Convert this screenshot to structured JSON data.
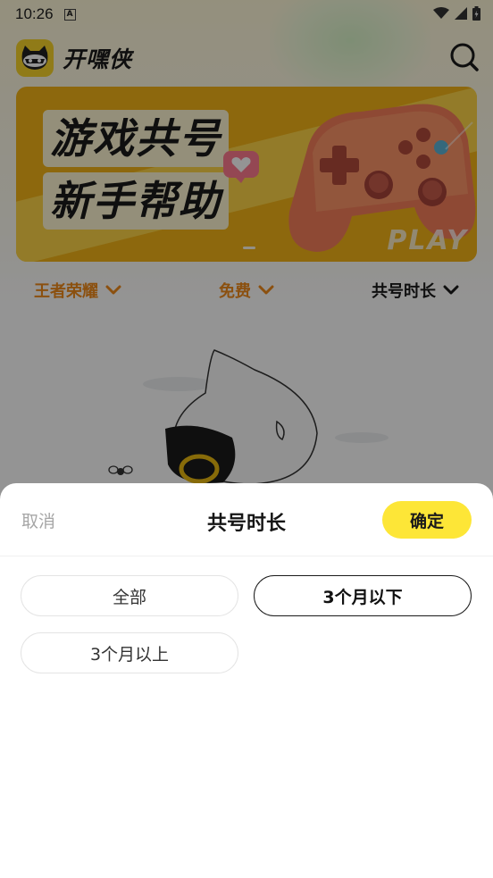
{
  "status_bar": {
    "time": "10:26",
    "notification_icon": "A"
  },
  "header": {
    "brand": "开嘿侠",
    "logo_icon": "raccoon-logo-icon",
    "search_icon": "search-icon"
  },
  "banner": {
    "line1": "游戏共号",
    "line2": "新手帮助",
    "overlay_text": "PLAY"
  },
  "filters": [
    {
      "label": "王者荣耀",
      "color": "#f08a1b"
    },
    {
      "label": "免费",
      "color": "#f08a1b"
    },
    {
      "label": "共号时长",
      "color": "#1a1a1a"
    }
  ],
  "sheet": {
    "cancel": "取消",
    "title": "共号时长",
    "confirm": "确定",
    "confirm_color": "#fde637",
    "options": [
      {
        "label": "全部",
        "selected": false
      },
      {
        "label": "3个月以下",
        "selected": true
      },
      {
        "label": "3个月以上",
        "selected": false
      }
    ]
  }
}
